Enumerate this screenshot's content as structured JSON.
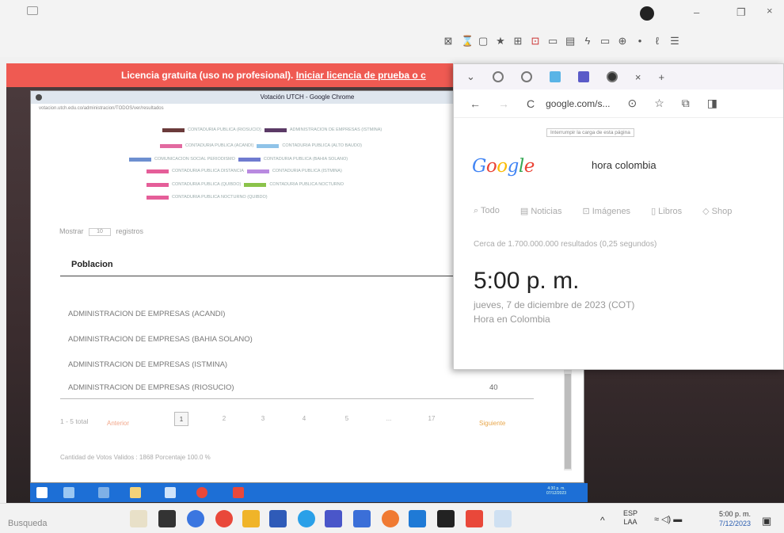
{
  "host_window": {
    "min_glyph": "–",
    "max_glyph": "❐",
    "close_glyph": "×",
    "toolbar_icons": [
      "⊠",
      "⌛",
      "▢",
      "★",
      "⊞",
      "⊡",
      "▭",
      "▤",
      "ϟ",
      "▭",
      "⊕",
      "•",
      "ℓ",
      "☰"
    ]
  },
  "license_banner": {
    "text": "Licencia gratuita (uso no profesional).",
    "link": "Iniciar licencia de prueba o c"
  },
  "inner_window": {
    "title": "Votación UTCH - Google Chrome",
    "address": "votacion.utch.edu.co/administracion/TODOS/ver/resultados"
  },
  "legend": {
    "rows": [
      {
        "items": [
          {
            "color": "#6b3b3b",
            "label": "CONTADURIA PUBLICA (RIOSUCIO)"
          },
          {
            "color": "#5b3a66",
            "label": "ADMINISTRACION DE EMPRESAS (ISTMINA)"
          },
          {
            "color": "#6b3b3b",
            "label": ""
          }
        ]
      },
      {
        "items": [
          {
            "color": "#e26aa0",
            "label": "CONTADURIA PUBLICA (ACANDI)"
          },
          {
            "color": "#8fc3e8",
            "label": "CONTADURIA PUBLICA (ALTO BAUDO)"
          }
        ]
      },
      {
        "items": [
          {
            "color": "#6d8fd0",
            "label": "COMUNICACION SOCIAL PERIODISMO"
          },
          {
            "color": "#6f7bd0",
            "label": "CONTADURIA PUBLICA (BAHIA SOLANO)"
          }
        ]
      },
      {
        "items": [
          {
            "color": "#e55e99",
            "label": "CONTADURIA PUBLICA DISTANCIA"
          },
          {
            "color": "#b98ae0",
            "label": "CONTADURIA PUBLICA (ISTMINA)"
          }
        ]
      },
      {
        "items": [
          {
            "color": "#e55e99",
            "label": "CONTADURIA PUBLICA (QUIBDO)"
          },
          {
            "color": "#8bc34a",
            "label": "CONTADURIA PUBLICA NOCTURNO"
          }
        ]
      },
      {
        "items": [
          {
            "color": "#e55e99",
            "label": "CONTADURIA PUBLICA NOCTURNO (QUIBDO)"
          }
        ]
      }
    ]
  },
  "table": {
    "show_label": "Mostrar",
    "show_value": "10",
    "show_suffix": "registros",
    "header": "Poblacion",
    "rows": [
      {
        "name": "ADMINISTRACION DE EMPRESAS (ACANDI)"
      },
      {
        "name": "ADMINISTRACION DE EMPRESAS (BAHIA SOLANO)"
      },
      {
        "name": "ADMINISTRACION DE EMPRESAS (ISTMINA)"
      },
      {
        "name": "ADMINISTRACION DE EMPRESAS (RIOSUCIO)",
        "value": "40"
      }
    ],
    "footer_info": "1 - 5 total",
    "prev": "Anterior",
    "pages": [
      "1",
      "2",
      "3",
      "4",
      "5",
      "...",
      "17"
    ],
    "next": "Siguiente",
    "valid_votes": "Cantidad de Votos Validos : 1868 Porcentaje 100.0 %"
  },
  "inner_taskbar": {
    "clock_time": "4:30 p. m.",
    "clock_date": "07/12/2023"
  },
  "google_popup": {
    "url": "google.com/s...",
    "tooltip": "Interrumpir la carga de esta página",
    "logo": "Google",
    "query": "hora colombia",
    "tabs": [
      "Todo",
      "Noticias",
      "Imágenes",
      "Libros",
      "Shop"
    ],
    "results": "Cerca de 1.700.000.000 resultados (0,25 segundos)",
    "time": "5:00 p. m.",
    "date": "jueves, 7 de diciembre de 2023 (COT)",
    "place": "Hora en Colombia"
  },
  "host_taskbar": {
    "search": "Busqueda",
    "lang_top": "ESP",
    "lang_bottom": "LAA",
    "time": "5:00 p. m.",
    "date": "7/12/2023"
  }
}
